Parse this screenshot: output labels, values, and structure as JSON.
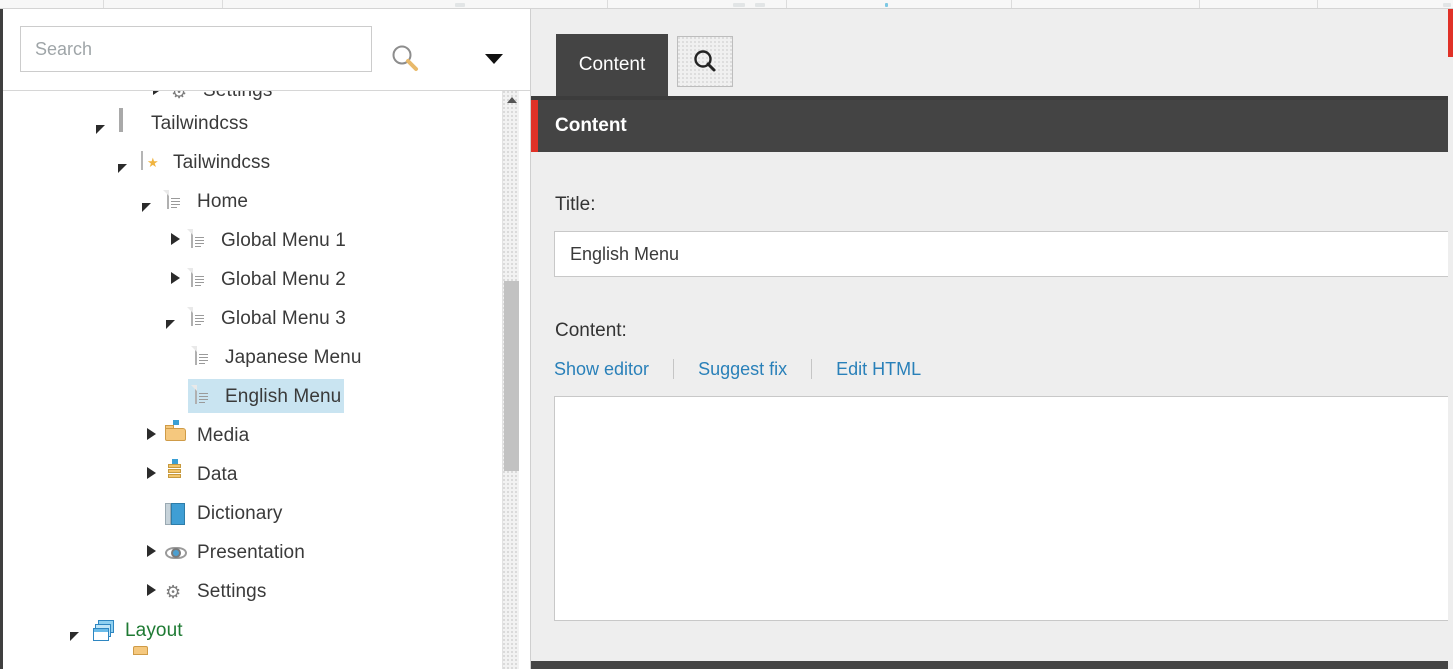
{
  "toolbar_sliver": {
    "present": true
  },
  "left_pane": {
    "search": {
      "placeholder": "Search",
      "value": "",
      "go_icon": "search-icon",
      "dropdown_icon": "chevron-down-icon"
    },
    "tree": {
      "items": [
        {
          "label": "Settings",
          "icon": "gear-icon",
          "indent": 0,
          "toggle": "collapsed",
          "selected": false,
          "partial": "top"
        },
        {
          "label": "Tailwindcss",
          "icon": "window-icon",
          "indent": 1,
          "toggle": "expanded",
          "selected": false
        },
        {
          "label": "Tailwindcss",
          "icon": "star-window-icon",
          "indent": 2,
          "toggle": "expanded",
          "selected": false
        },
        {
          "label": "Home",
          "icon": "document-icon",
          "indent": 3,
          "toggle": "expanded",
          "selected": false
        },
        {
          "label": "Global Menu 1",
          "icon": "document-icon",
          "indent": 4,
          "toggle": "collapsed",
          "selected": false
        },
        {
          "label": "Global Menu 2",
          "icon": "document-icon",
          "indent": 4,
          "toggle": "collapsed",
          "selected": false
        },
        {
          "label": "Global Menu 3",
          "icon": "document-icon",
          "indent": 4,
          "toggle": "expanded",
          "selected": false
        },
        {
          "label": "Japanese Menu",
          "icon": "document-icon",
          "indent": 5,
          "toggle": "none",
          "selected": false
        },
        {
          "label": "English Menu",
          "icon": "document-icon",
          "indent": 5,
          "toggle": "none",
          "selected": true
        },
        {
          "label": "Media",
          "icon": "folder-icon",
          "indent": 3,
          "toggle": "collapsed",
          "selected": false
        },
        {
          "label": "Data",
          "icon": "data-icon",
          "indent": 3,
          "toggle": "collapsed",
          "selected": false
        },
        {
          "label": "Dictionary",
          "icon": "dictionary-icon",
          "indent": 3,
          "toggle": "none",
          "selected": false
        },
        {
          "label": "Presentation",
          "icon": "eye-icon",
          "indent": 3,
          "toggle": "collapsed",
          "selected": false
        },
        {
          "label": "Settings",
          "icon": "gear-icon",
          "indent": 3,
          "toggle": "collapsed",
          "selected": false
        },
        {
          "label": "Layout",
          "icon": "layout-icon",
          "indent": 1,
          "toggle": "expanded",
          "selected": false,
          "green": true
        }
      ],
      "scrollbar": {
        "up_arrow": "scroll-up-arrow-icon",
        "thumb_top_pct": 33,
        "thumb_height_pct": 33
      }
    }
  },
  "right_pane": {
    "tabs": [
      {
        "label": "Content",
        "active": true
      },
      {
        "label": "",
        "icon": "search-icon",
        "active": false
      }
    ],
    "section": {
      "title": "Content",
      "accent_color": "#e03127",
      "bar_color": "#444444"
    },
    "form": {
      "title_label": "Title:",
      "title_value": "English Menu",
      "title_placeholder": "",
      "content_label": "Content:",
      "editor_links": [
        {
          "label": "Show editor"
        },
        {
          "label": "Suggest fix"
        },
        {
          "label": "Edit HTML"
        }
      ],
      "content_value": "",
      "content_placeholder": ""
    }
  },
  "colors": {
    "selection_blue": "#c9e4f1",
    "link_blue": "#2980b9",
    "accent_red": "#e03127",
    "header_dark": "#444444",
    "pane_bg": "#eeeeee",
    "tree_green": "#1e7a33"
  }
}
